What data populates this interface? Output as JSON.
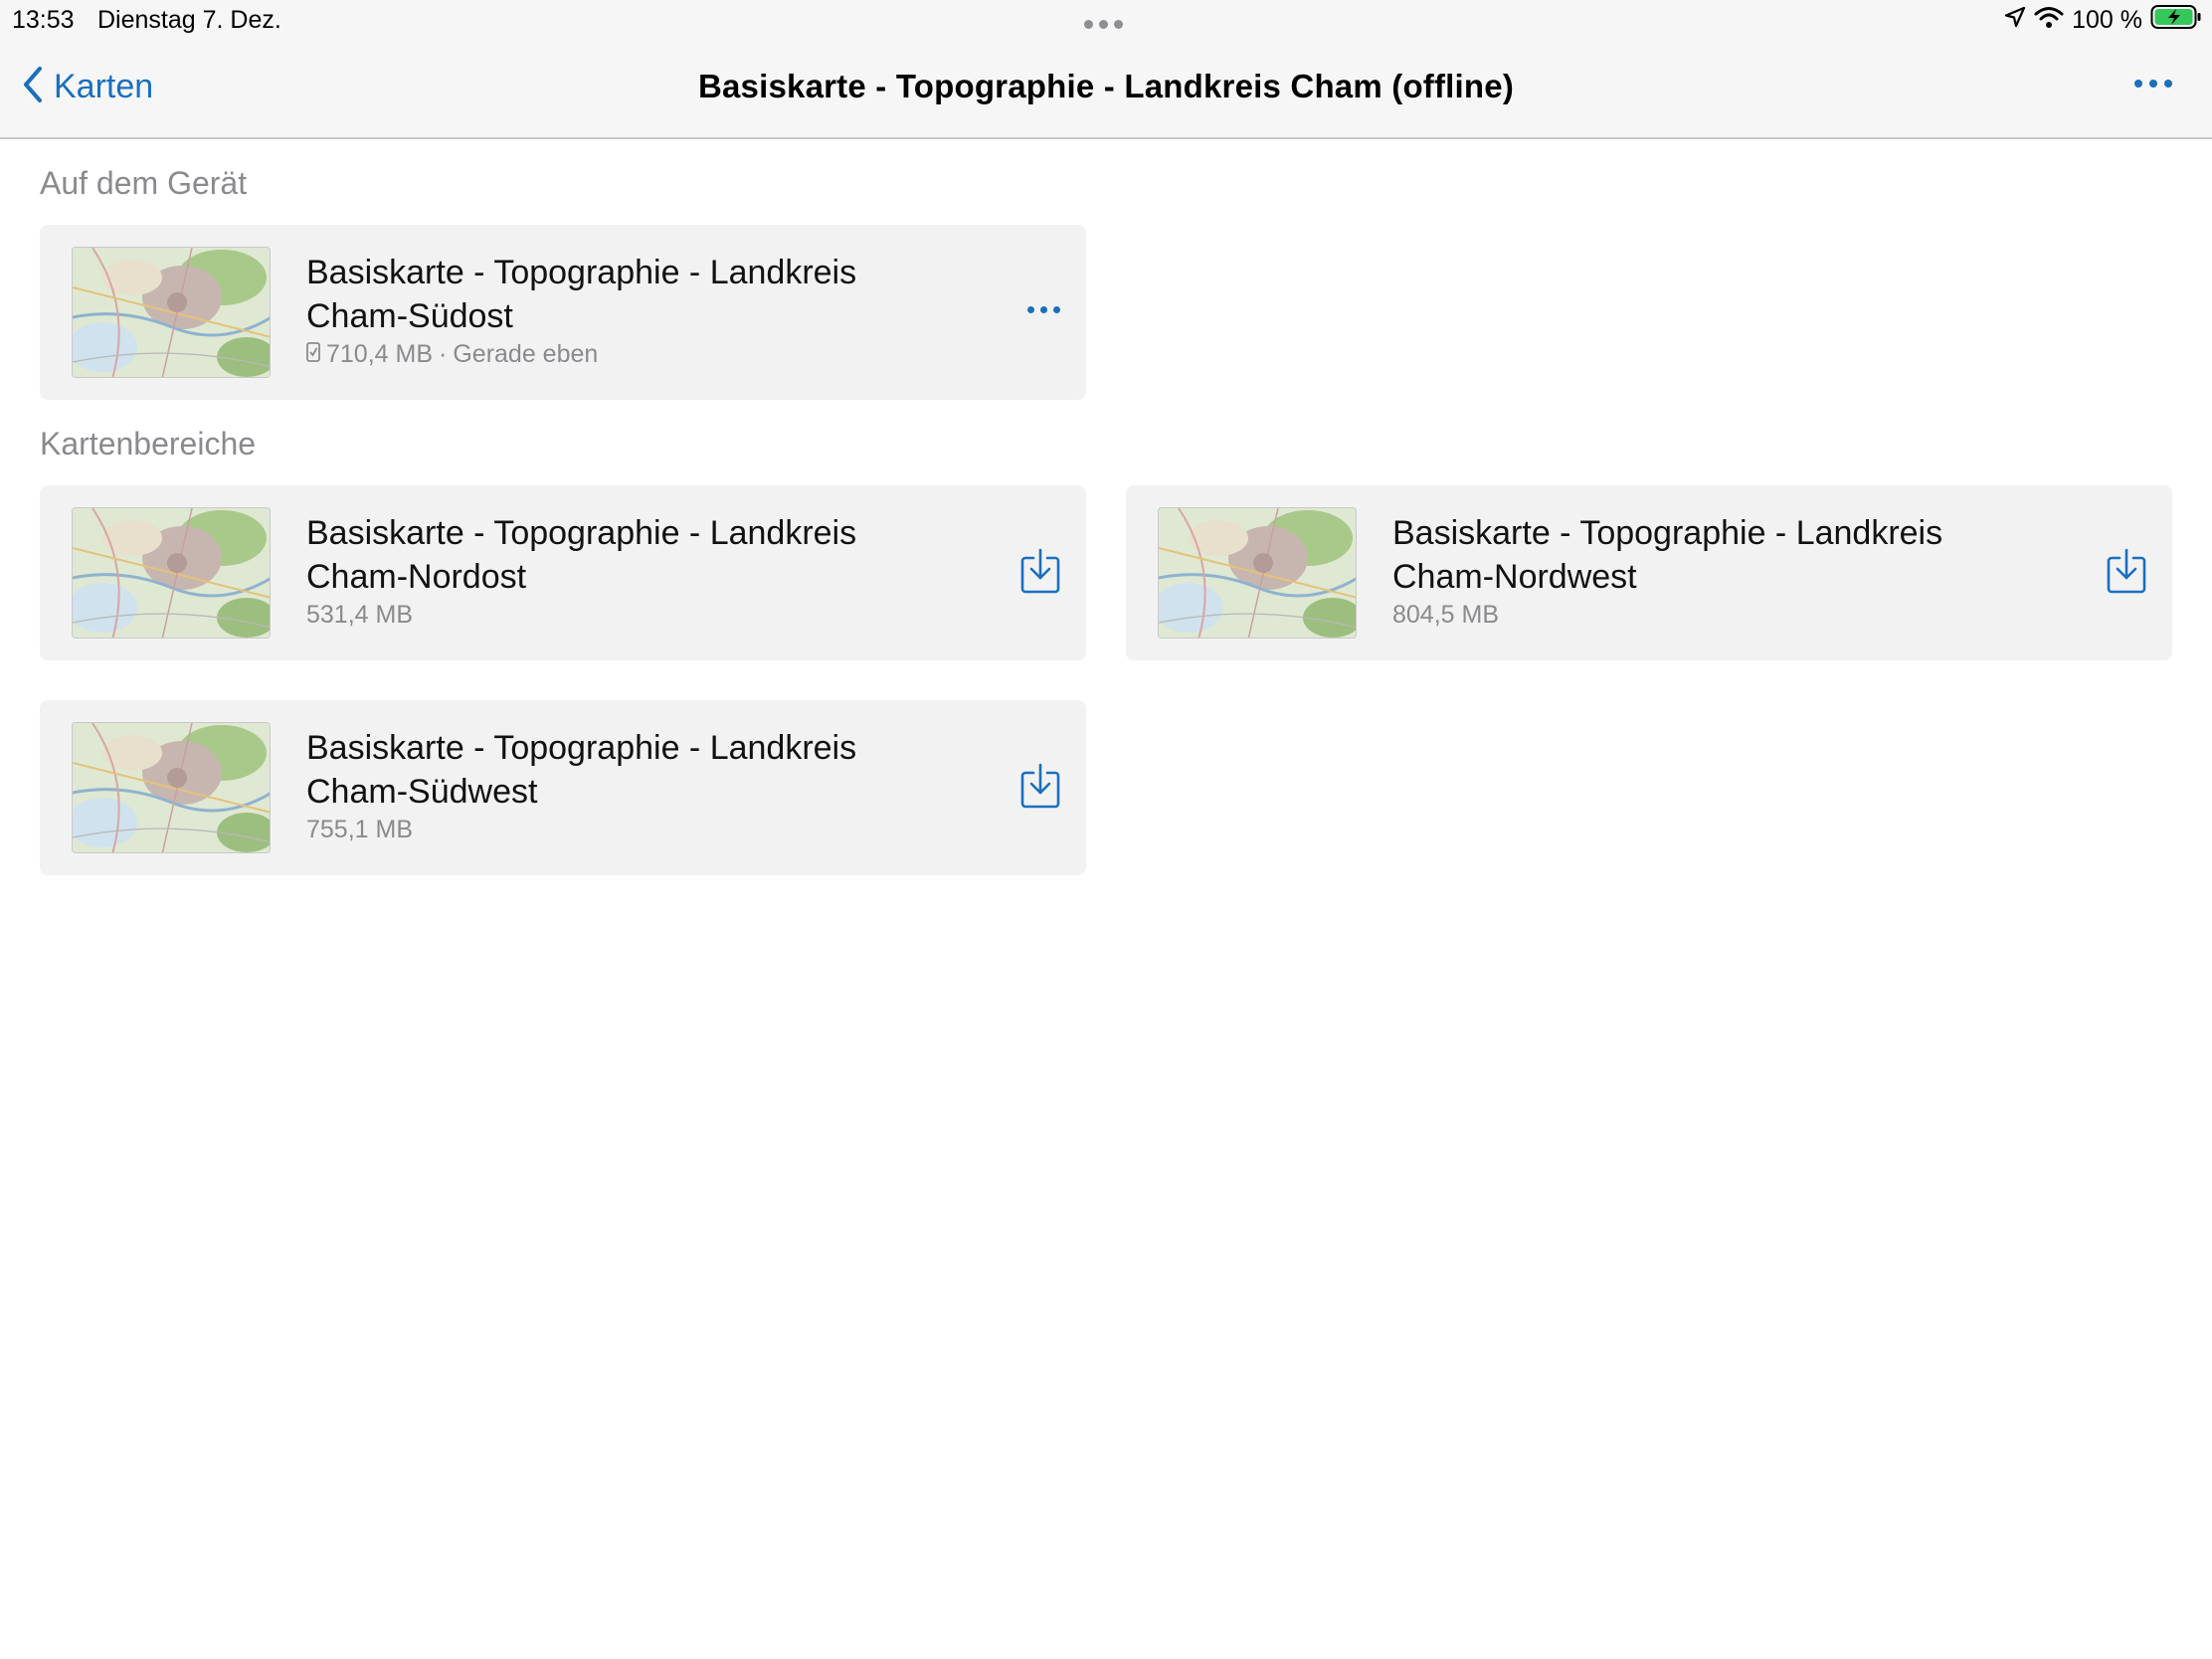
{
  "status_bar": {
    "time": "13:53",
    "date": "Dienstag 7. Dez.",
    "battery": "100 %",
    "icons": [
      "location-arrow-icon",
      "wifi-icon",
      "battery-charging-icon"
    ]
  },
  "nav": {
    "back_label": "Karten",
    "title": "Basiskarte - Topographie - Landkreis Cham (offline)"
  },
  "colors": {
    "accent": "#1a6fbd",
    "card_bg": "#f2f2f2",
    "secondary_text": "#8a8a8e"
  },
  "sections": {
    "on_device": {
      "header": "Auf dem Gerät",
      "items": [
        {
          "title_line1": "Basiskarte - Topographie - Landkreis",
          "title_line2": "Cham-Südost",
          "size": "710,4 MB",
          "separator": "·",
          "updated": "Gerade eben",
          "action_icon": "more-horizontal-icon"
        }
      ]
    },
    "map_areas": {
      "header": "Kartenbereiche",
      "items": [
        {
          "title_line1": "Basiskarte - Topographie - Landkreis",
          "title_line2": "Cham-Nordost",
          "size": "531,4 MB",
          "action_icon": "download-icon"
        },
        {
          "title_line1": "Basiskarte - Topographie - Landkreis",
          "title_line2": "Cham-Nordwest",
          "size": "804,5 MB",
          "action_icon": "download-icon"
        },
        {
          "title_line1": "Basiskarte - Topographie - Landkreis",
          "title_line2": "Cham-Südwest",
          "size": "755,1 MB",
          "action_icon": "download-icon"
        }
      ]
    }
  }
}
